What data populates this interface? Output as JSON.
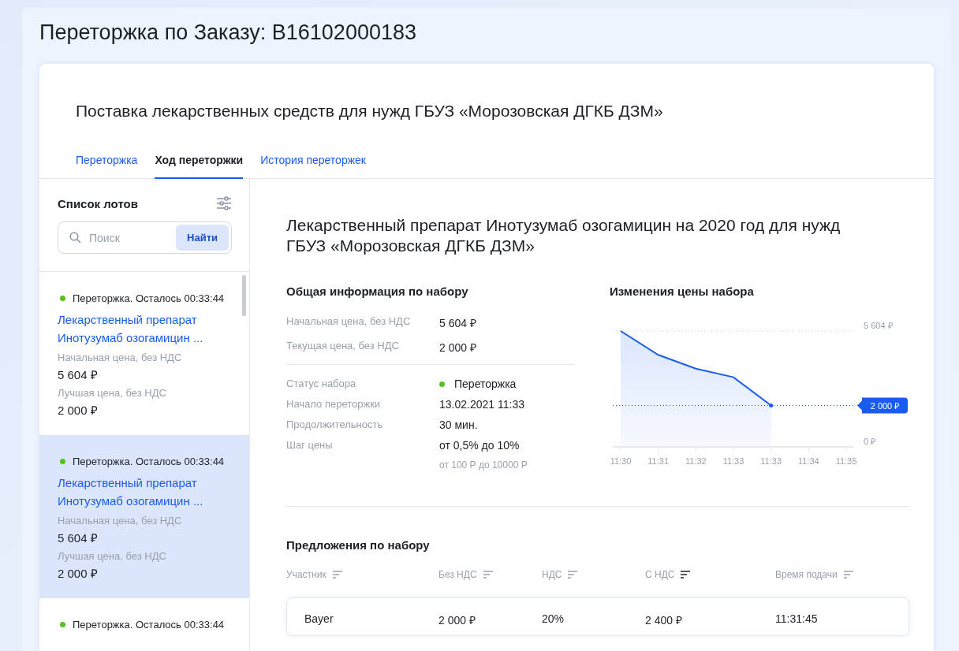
{
  "page_title": "Переторжка по Заказу: B16102000183",
  "card_title": "Поставка лекарственных средств для нужд ГБУЗ «Морозовская ДГКБ ДЗМ»",
  "tabs": [
    {
      "label": "Переторжка",
      "selected": false
    },
    {
      "label": "Ход переторжки",
      "selected": true
    },
    {
      "label": "История переторжек",
      "selected": false
    }
  ],
  "lot_list": {
    "title": "Список лотов",
    "search": {
      "placeholder": "Поиск",
      "button": "Найти"
    },
    "lots": [
      {
        "status": "Переторжка. Осталось 00:33:44",
        "color": "#52c41a",
        "selected": false,
        "name": "Лекарственный препарат Инотузумаб озогамицин ...",
        "start_label": "Начальная цена, без НДС",
        "start_price": "5 604 ₽",
        "best_label": "Лучшая цена, без НДС",
        "best_price": "2 000 ₽"
      },
      {
        "status": "Переторжка. Осталось 00:33:44",
        "color": "#52c41a",
        "selected": true,
        "name": "Лекарственный препарат Инотузумаб озогамицин ...",
        "start_label": "Начальная цена, без НДС",
        "start_price": "5 604 ₽",
        "best_label": "Лучшая цена, без НДС",
        "best_price": "2 000 ₽"
      },
      {
        "status": "Переторжка. Осталось 00:33:44",
        "color": "#52c41a",
        "selected": false
      }
    ]
  },
  "lot_title": "Лекарственный препарат Инотузумаб озогамицин на 2020 год для нужд ГБУЗ «Морозовская ДГКБ ДЗМ»",
  "info": {
    "title": "Общая информация по набору",
    "prices": [
      {
        "label": "Начальная цена, без НДС",
        "value": "5 604 ₽"
      },
      {
        "label": "Текущая цена, без НДС",
        "value": "2 000 ₽"
      }
    ],
    "details": [
      {
        "label": "Статус набора",
        "value": "Переторжка",
        "color": "#52c41a"
      },
      {
        "label": "Начало переторжки",
        "value": "13.02.2021 11:33"
      },
      {
        "label": "Продолжительность",
        "value": "30 мин."
      },
      {
        "label": "Шаг цены",
        "value": "от 0,5% до 10%",
        "note": "от 100 Р до 10000 Р"
      }
    ]
  },
  "price_chart": {
    "title": "Изменения цены набора",
    "chart_data": {
      "type": "area",
      "categories": [
        "11:30",
        "11:31",
        "11:32",
        "11:33",
        "11:33",
        "11:34",
        "11:35"
      ],
      "values": [
        5604,
        4450,
        3780,
        3370,
        2000,
        null,
        null
      ],
      "ylim": [
        0,
        5604
      ],
      "yticks": [
        {
          "value": 0,
          "label": "0 ₽"
        },
        {
          "value": 5604,
          "label": "5 604 ₽"
        }
      ],
      "ref_lines": [
        {
          "axis": "y",
          "value": 2000,
          "label": "2 000 ₽"
        }
      ]
    }
  },
  "offers": {
    "title": "Предложения по набору",
    "columns": [
      {
        "label": "Участник",
        "sorted": false
      },
      {
        "label": "Без НДС",
        "sorted": false
      },
      {
        "label": "НДС",
        "sorted": false
      },
      {
        "label": "С НДС",
        "sorted": true
      },
      {
        "label": "Время подачи",
        "sorted": false
      }
    ],
    "rows": [
      [
        "Bayer",
        "2 000 ₽",
        "20%",
        "2 400 ₽",
        "11:31:45"
      ]
    ]
  }
}
